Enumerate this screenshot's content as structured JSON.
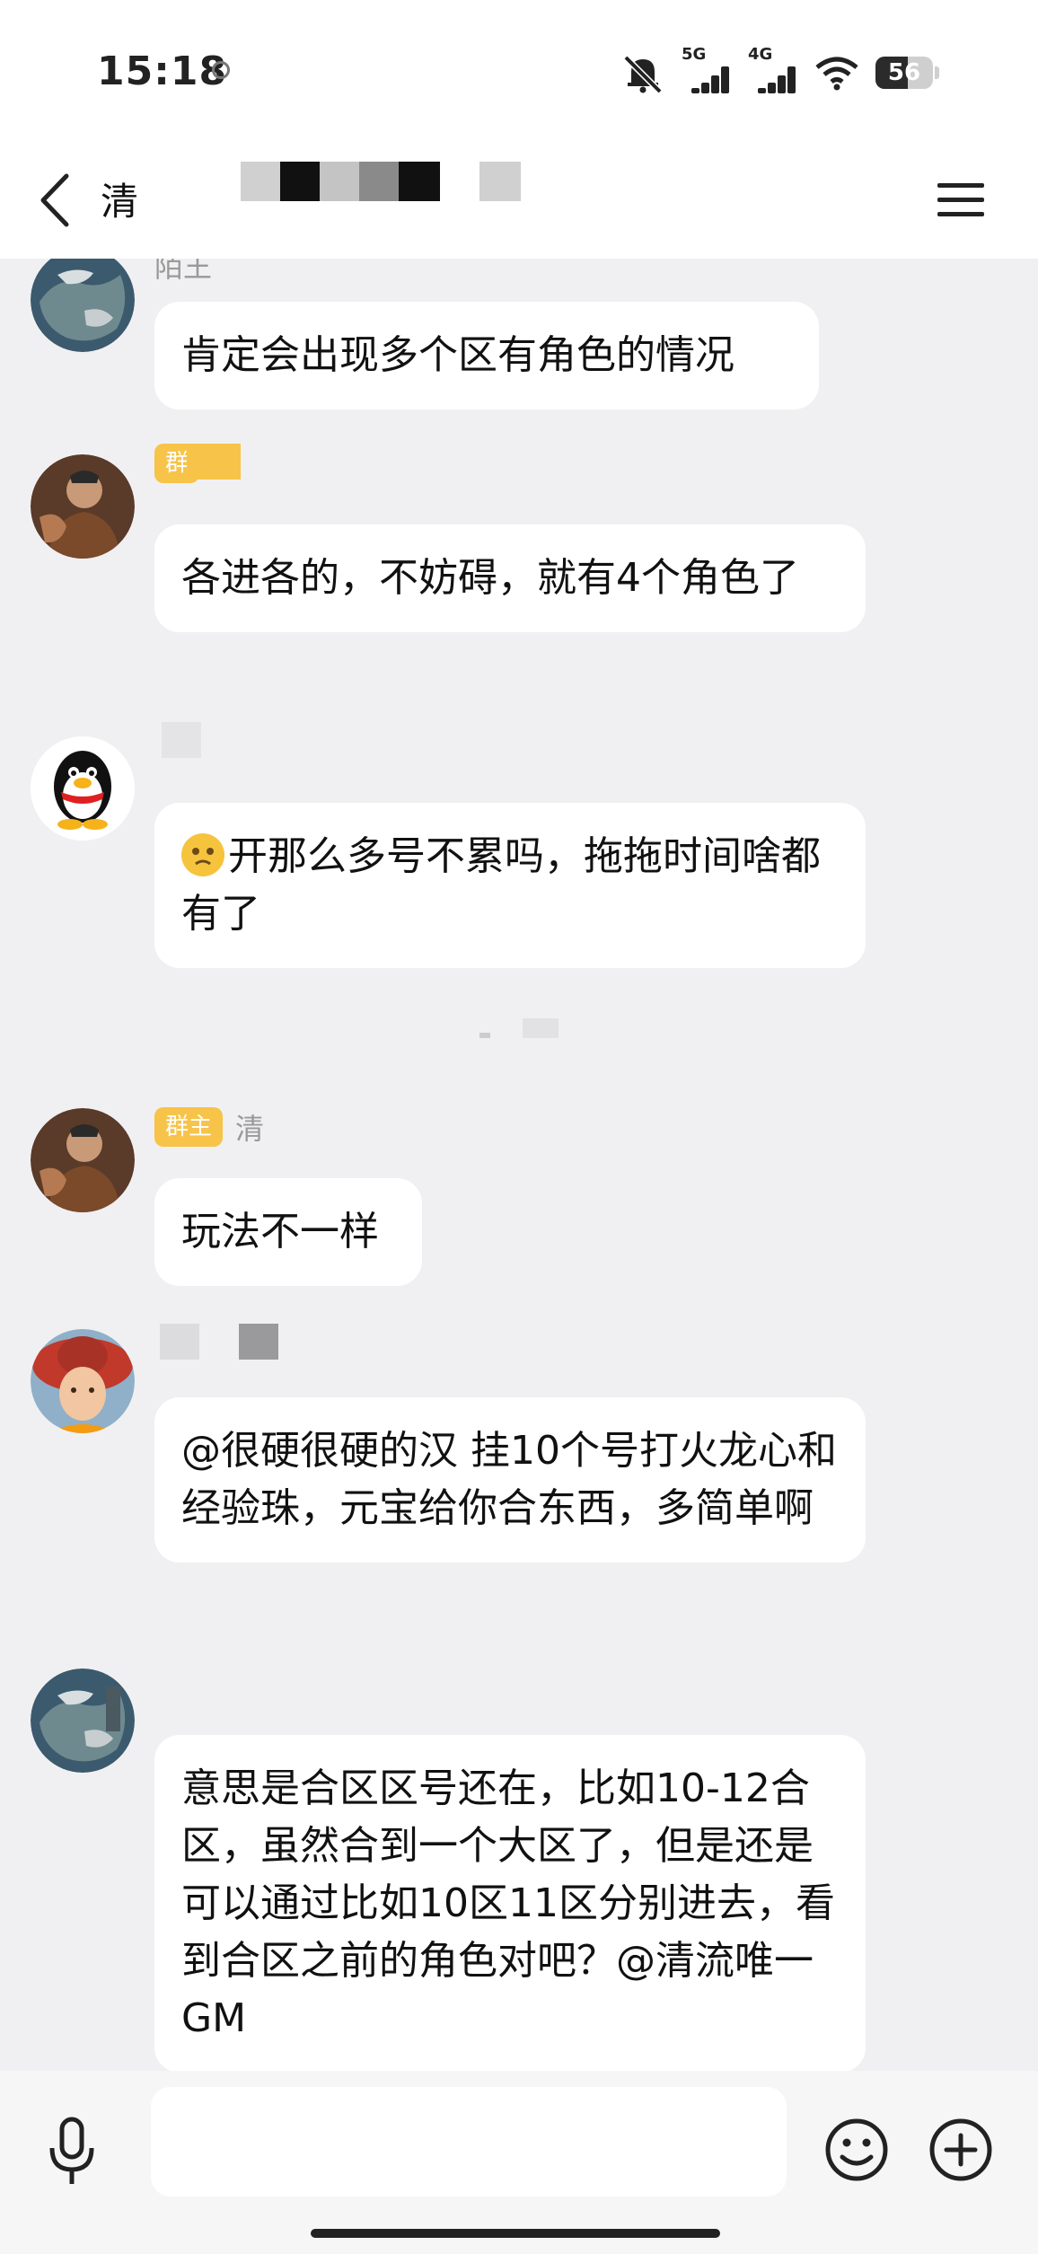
{
  "status_bar": {
    "time": "15:18",
    "network1": "5G",
    "network2": "4G",
    "battery": "56",
    "battery_level_percent": 56
  },
  "header": {
    "title": "清"
  },
  "messages": [
    {
      "sender_name": "陌王",
      "badge": "",
      "text": "肯定会出现多个区有角色的情况"
    },
    {
      "sender_name": "",
      "badge": "群",
      "text": "各进各的，不妨碍，就有4个角色了"
    },
    {
      "sender_name": "",
      "badge": "",
      "emoji": "pleading-face",
      "text": "开那么多号不累吗，拖拖时间啥都有了"
    },
    {
      "sender_name": "清",
      "badge": "群主",
      "text": "玩法不一样"
    },
    {
      "sender_name": "",
      "badge": "",
      "text": "@很硬很硬的汉 挂10个号打火龙心和经验珠，元宝给你合东西，多简单啊"
    },
    {
      "sender_name": "",
      "badge": "",
      "text": "意思是合区区号还在，比如10-12合区，虽然合到一个大区了，但是还是可以通过比如10区11区分别进去，看到合区之前的角色对吧？@清流唯一GM"
    }
  ],
  "input": {
    "placeholder": "",
    "value": ""
  },
  "colors": {
    "badge": "#f7c348",
    "background": "#f0f0f2",
    "bubble": "#ffffff"
  },
  "icons": [
    "back-icon",
    "menu-icon",
    "mic-icon",
    "emoji-icon",
    "plus-icon"
  ]
}
